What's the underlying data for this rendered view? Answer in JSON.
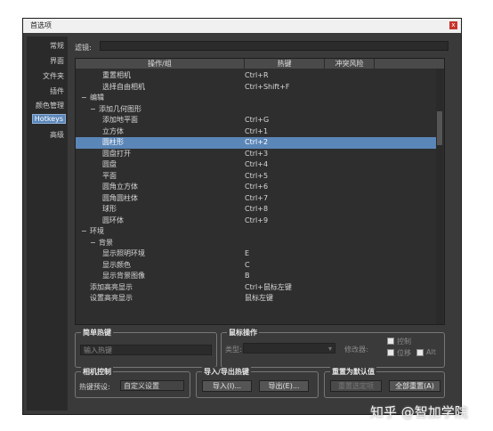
{
  "window": {
    "title": "首选项",
    "close_glyph": "x"
  },
  "sidebar": {
    "items": [
      "常规",
      "界面",
      "文件夹",
      "插件",
      "颜色管理",
      "Hotkeys",
      "高级"
    ]
  },
  "filter": {
    "label": "滤镜:"
  },
  "tree": {
    "columns": [
      "操作/组",
      "热键",
      "冲突风险"
    ],
    "rows": [
      {
        "name": "重置相机",
        "key": "Ctrl+R",
        "indent": 2
      },
      {
        "name": "选择自由相机",
        "key": "Ctrl+Shift+F",
        "indent": 2
      },
      {
        "name": "编辑",
        "key": "",
        "indent": 0,
        "expander": "−"
      },
      {
        "name": "添加几何图形",
        "key": "",
        "indent": 1,
        "expander": "−"
      },
      {
        "name": "添加地平面",
        "key": "Ctrl+G",
        "indent": 2
      },
      {
        "name": "立方体",
        "key": "Ctrl+1",
        "indent": 2
      },
      {
        "name": "圆柱形",
        "key": "Ctrl+2",
        "indent": 2,
        "selected": true
      },
      {
        "name": "圆盘打开",
        "key": "Ctrl+3",
        "indent": 2
      },
      {
        "name": "圆盘",
        "key": "Ctrl+4",
        "indent": 2
      },
      {
        "name": "平面",
        "key": "Ctrl+5",
        "indent": 2
      },
      {
        "name": "圆角立方体",
        "key": "Ctrl+6",
        "indent": 2
      },
      {
        "name": "圆角圆柱体",
        "key": "Ctrl+7",
        "indent": 2
      },
      {
        "name": "球形",
        "key": "Ctrl+8",
        "indent": 2
      },
      {
        "name": "圆环体",
        "key": "Ctrl+9",
        "indent": 2
      },
      {
        "name": "环境",
        "key": "",
        "indent": 0,
        "expander": "−"
      },
      {
        "name": "背景",
        "key": "",
        "indent": 1,
        "expander": "−"
      },
      {
        "name": "显示照明环境",
        "key": "E",
        "indent": 2
      },
      {
        "name": "显示颜色",
        "key": "C",
        "indent": 2
      },
      {
        "name": "显示背景图像",
        "key": "B",
        "indent": 2
      },
      {
        "name": "添加高亮显示",
        "key": "Ctrl+鼠标左键",
        "indent": 1
      },
      {
        "name": "设置高亮显示",
        "key": "鼠标左键",
        "indent": 1
      }
    ]
  },
  "simple_hotkey": {
    "title": "简单热键",
    "placeholder": "输入热键"
  },
  "mouse_op": {
    "title": "鼠标操作",
    "type_label": "类型:",
    "modifier_label": "修改器:",
    "ctrl": "控制",
    "shift": "位移",
    "alt": "Alt"
  },
  "camera_ctrl": {
    "title": "相机控制",
    "preset_label": "热键预设:",
    "preset_value": "自定义设置"
  },
  "import_export": {
    "title": "导入/导出热键",
    "import": "导入(I)...",
    "export": "导出(E)..."
  },
  "reset": {
    "title": "重置为默认值",
    "reset_selected": "重置选定项",
    "reset_all": "全部重置(A)"
  },
  "watermark": "知乎 @智加学院"
}
